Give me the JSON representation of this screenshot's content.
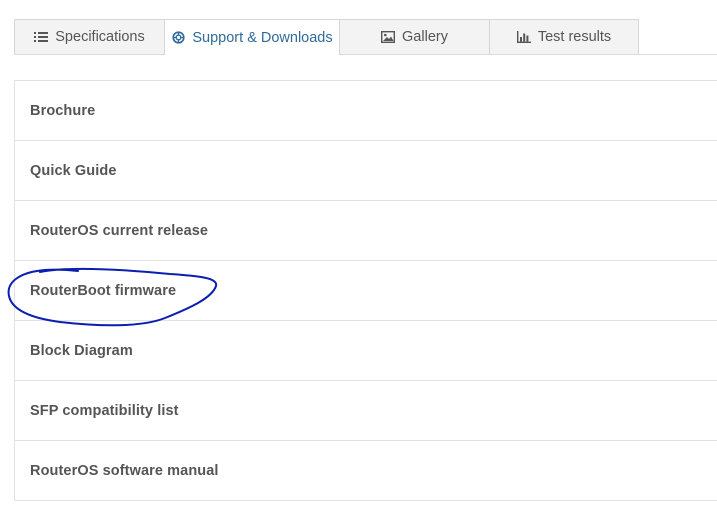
{
  "tabs": [
    {
      "label": "Specifications",
      "icon": "list-icon",
      "active": false
    },
    {
      "label": "Support & Downloads",
      "icon": "lifebuoy-icon",
      "active": true
    },
    {
      "label": "Gallery",
      "icon": "image-icon",
      "active": false
    },
    {
      "label": "Test results",
      "icon": "bar-chart-icon",
      "active": false
    }
  ],
  "downloads": [
    {
      "label": "Brochure"
    },
    {
      "label": "Quick Guide"
    },
    {
      "label": "RouterOS current release"
    },
    {
      "label": "RouterBoot firmware",
      "annotated": true
    },
    {
      "label": "Block Diagram"
    },
    {
      "label": "SFP compatibility list"
    },
    {
      "label": "RouterOS software manual"
    }
  ],
  "colors": {
    "active_tab_text": "#2f6b9a",
    "tab_text": "#555555",
    "item_text": "#555555",
    "annotation_ink": "#0a1fb0",
    "border": "#e2e2e2"
  }
}
